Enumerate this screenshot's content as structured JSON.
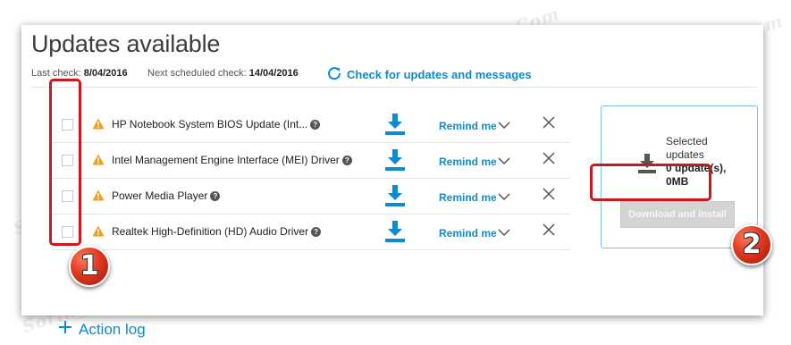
{
  "header": {
    "title": "Updates available",
    "last_check_label": "Last check:",
    "last_check_value": "8/04/2016",
    "next_check_label": "Next scheduled check:",
    "next_check_value": "14/04/2016",
    "check_link": "Check for updates and messages"
  },
  "updates": [
    {
      "name": "HP Notebook System BIOS Update (Int...",
      "remind": "Remind me",
      "checked": false
    },
    {
      "name": "Intel Management Engine Interface (MEI) Driver",
      "remind": "Remind me",
      "checked": false
    },
    {
      "name": "Power Media Player",
      "remind": "Remind me",
      "checked": false
    },
    {
      "name": "Realtek High-Definition (HD) Audio Driver",
      "remind": "Remind me",
      "checked": false
    }
  ],
  "selected_panel": {
    "line1": "Selected",
    "line2": "updates",
    "line3": "0 update(s),",
    "line4": "0MB",
    "install_button": "Download and install"
  },
  "footer": {
    "action_log": "Action log"
  },
  "callouts": [
    "1",
    "2"
  ],
  "watermark": "Soringpcrepair.Com",
  "colors": {
    "accent": "#0a8dd0",
    "warning": "#f0a020",
    "highlight": "#c9191e",
    "button_disabled": "#d4d4d4"
  },
  "icons": [
    "refresh-icon",
    "warning-icon",
    "help-icon",
    "download-icon",
    "chevron-down-icon",
    "close-icon",
    "plus-icon"
  ]
}
